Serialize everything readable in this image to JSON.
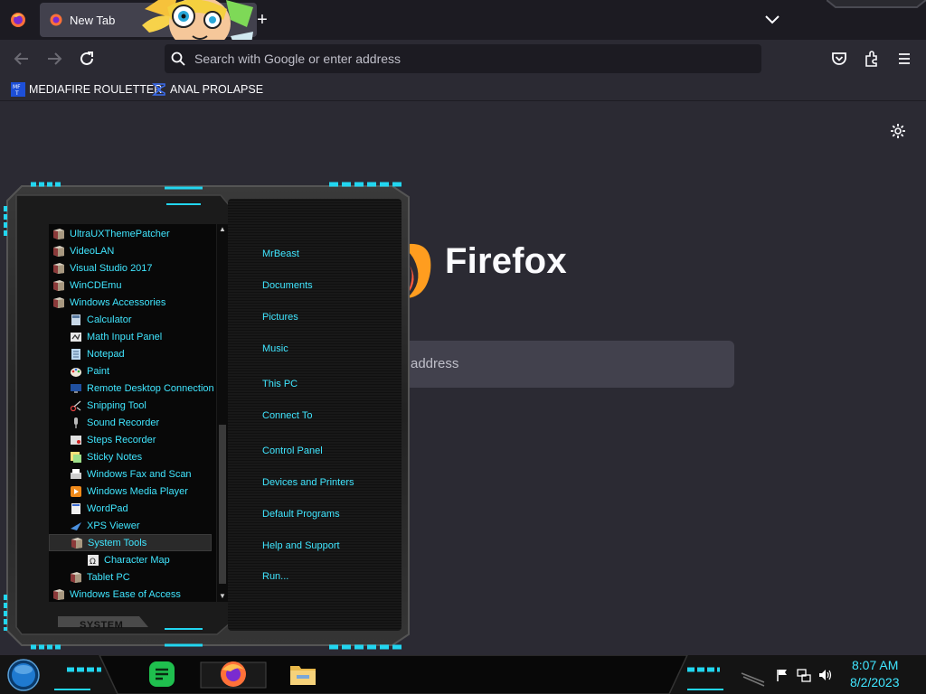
{
  "browser": {
    "tab_title": "New Tab",
    "url_placeholder": "Search with Google or enter address",
    "bookmarks": [
      {
        "label": "MEDIAFIRE ROULETTER",
        "icon": "mediafire-icon"
      },
      {
        "label": "ANAL PROLAPSE",
        "icon": "bookmark-sigma-icon"
      }
    ],
    "brand": "Firefox",
    "home_search_placeholder": "address"
  },
  "start_menu": {
    "programs": [
      {
        "label": "UltraUXThemePatcher",
        "icon": "folder-icon",
        "indent": 0
      },
      {
        "label": "VideoLAN",
        "icon": "folder-icon",
        "indent": 0
      },
      {
        "label": "Visual Studio 2017",
        "icon": "folder-icon",
        "indent": 0
      },
      {
        "label": "WinCDEmu",
        "icon": "folder-icon",
        "indent": 0
      },
      {
        "label": "Windows Accessories",
        "icon": "folder-icon",
        "indent": 0
      },
      {
        "label": "Calculator",
        "icon": "calculator-icon",
        "indent": 1
      },
      {
        "label": "Math Input Panel",
        "icon": "math-input-icon",
        "indent": 1
      },
      {
        "label": "Notepad",
        "icon": "notepad-icon",
        "indent": 1
      },
      {
        "label": "Paint",
        "icon": "paint-icon",
        "indent": 1
      },
      {
        "label": "Remote Desktop Connection",
        "icon": "remote-desktop-icon",
        "indent": 1
      },
      {
        "label": "Snipping Tool",
        "icon": "snipping-tool-icon",
        "indent": 1
      },
      {
        "label": "Sound Recorder",
        "icon": "microphone-icon",
        "indent": 1
      },
      {
        "label": "Steps Recorder",
        "icon": "steps-recorder-icon",
        "indent": 1
      },
      {
        "label": "Sticky Notes",
        "icon": "sticky-notes-icon",
        "indent": 1
      },
      {
        "label": "Windows Fax and Scan",
        "icon": "fax-icon",
        "indent": 1
      },
      {
        "label": "Windows Media Player",
        "icon": "media-player-icon",
        "indent": 1
      },
      {
        "label": "WordPad",
        "icon": "wordpad-icon",
        "indent": 1
      },
      {
        "label": "XPS Viewer",
        "icon": "xps-viewer-icon",
        "indent": 1
      },
      {
        "label": "System Tools",
        "icon": "folder-icon",
        "indent": 1,
        "selected": true
      },
      {
        "label": "Character Map",
        "icon": "character-map-icon",
        "indent": 2
      },
      {
        "label": "Tablet PC",
        "icon": "folder-icon",
        "indent": 1
      },
      {
        "label": "Windows Ease of Access",
        "icon": "folder-icon",
        "indent": 0
      }
    ],
    "links": [
      "MrBeast",
      "Documents",
      "Pictures",
      "Music",
      "This PC",
      "Connect To",
      "Control Panel",
      "Devices and Printers",
      "Default Programs",
      "Help and Support",
      "Run..."
    ],
    "footer_label": "SYSTEM"
  },
  "taskbar": {
    "time": "8:07 AM",
    "date": "8/2/2023",
    "pinned": [
      "notes-app-icon",
      "firefox-icon",
      "file-explorer-icon"
    ],
    "tray": [
      "flag-icon",
      "network-icon",
      "volume-icon"
    ]
  },
  "colors": {
    "accent_cyan": "#40e6ff",
    "browser_bg": "#2b2a33",
    "tabbar_bg": "#1c1b22"
  }
}
